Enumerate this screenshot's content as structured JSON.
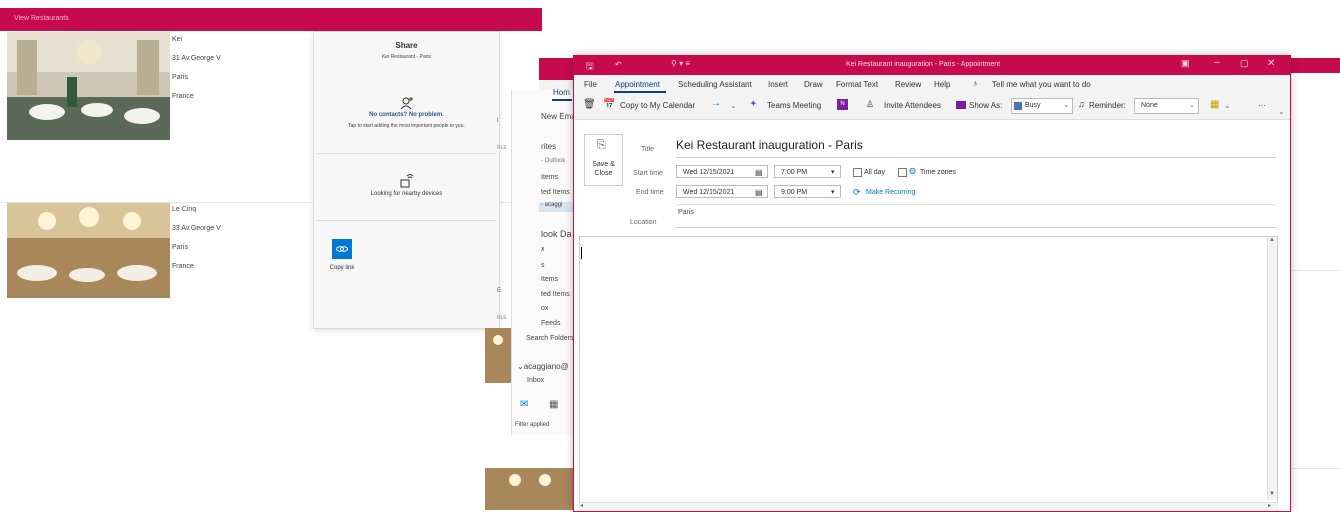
{
  "app": {
    "header": "View Restaurants",
    "restaurants": [
      {
        "name": "Kei",
        "street": "31 Av.George V",
        "city": "Paris",
        "country": "France"
      },
      {
        "name": "Le Cinq",
        "street": "33 Av.George V",
        "city": "Paris",
        "country": "France"
      }
    ]
  },
  "share": {
    "title": "Share",
    "subtitle": "Kei Restaurant - Paris",
    "contacts_title": "No contacts? No problem.",
    "contacts_text": "Tap to start adding the most important people to you.",
    "nearby": "Looking for nearby devices",
    "copy_link": "Copy link"
  },
  "outlook_main": {
    "tab_home": "Hom",
    "new_email": "New Ema",
    "favorites": "rites",
    "folders": [
      "- Outlook",
      "Items",
      "ted Items",
      "- acaggi"
    ],
    "group": "look Da",
    "group_items": [
      "x",
      "s",
      "Items",
      "ted Items",
      "ox",
      "Feeds",
      "Search Folders"
    ],
    "account": "acaggiano@",
    "inbox": "Inbox",
    "status": "Filter applied",
    "side_labels": [
      "t",
      "RLE",
      "E",
      "RLE"
    ]
  },
  "appointment": {
    "window_title": "Kei Restaurant inauguration - Paris  -  Appointment",
    "menu": [
      "File",
      "Appointment",
      "Scheduling Assistant",
      "Insert",
      "Draw",
      "Format Text",
      "Review",
      "Help"
    ],
    "tell_me": "Tell me what you want to do",
    "toolbar": {
      "copy_calendar": "Copy to My Calendar",
      "teams": "Teams Meeting",
      "invite": "Invite Attendees",
      "show_as": "Show As:",
      "show_as_value": "Busy",
      "reminder": "Reminder:",
      "reminder_value": "None",
      "more": "···"
    },
    "save_close": "Save & Close",
    "labels": {
      "title": "Title",
      "start": "Start time",
      "end": "End time",
      "location": "Location"
    },
    "title_value": "Kei Restaurant inauguration - Paris",
    "start_date": "Wed 12/15/2021",
    "start_time": "7:00 PM",
    "end_date": "Wed 12/15/2021",
    "end_time": "9:00 PM",
    "all_day": "All day",
    "time_zones": "Time zones",
    "make_recurring": "Make Recurring",
    "location_value": "Paris"
  },
  "colors": {
    "brand": "#c70a4b",
    "accent": "#0078d4"
  }
}
